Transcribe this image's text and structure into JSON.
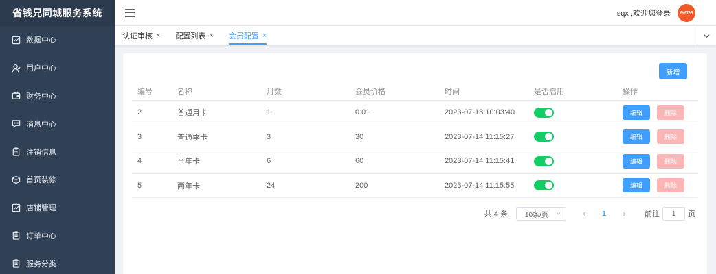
{
  "app": {
    "title": "省钱兄同城服务系统"
  },
  "sidebar": {
    "items": [
      {
        "label": "数据中心",
        "icon": "chart-icon"
      },
      {
        "label": "用户中心",
        "icon": "user-icon"
      },
      {
        "label": "财务中心",
        "icon": "wallet-icon"
      },
      {
        "label": "消息中心",
        "icon": "message-icon"
      },
      {
        "label": "注销信息",
        "icon": "clipboard-icon"
      },
      {
        "label": "首页装修",
        "icon": "box-icon"
      },
      {
        "label": "店铺管理",
        "icon": "chart-icon"
      },
      {
        "label": "订单中心",
        "icon": "clipboard-icon"
      },
      {
        "label": "服务分类",
        "icon": "clipboard-icon"
      }
    ]
  },
  "header": {
    "welcome": "sqx ,欢迎您登录",
    "avatar_text": "AVATAR"
  },
  "tabs": [
    {
      "label": "认证审核",
      "active": false
    },
    {
      "label": "配置列表",
      "active": false
    },
    {
      "label": "会员配置",
      "active": true
    }
  ],
  "toolbar": {
    "add_label": "新增"
  },
  "table": {
    "columns": [
      "编号",
      "名称",
      "月数",
      "会员价格",
      "时间",
      "是否启用",
      "操作"
    ],
    "rows": [
      {
        "id": "2",
        "name": "普通月卡",
        "months": "1",
        "price": "0.01",
        "time": "2023-07-18 10:03:40",
        "enabled": true
      },
      {
        "id": "3",
        "name": "普通季卡",
        "months": "3",
        "price": "30",
        "time": "2023-07-14 11:15:27",
        "enabled": true
      },
      {
        "id": "4",
        "name": "半年卡",
        "months": "6",
        "price": "60",
        "time": "2023-07-14 11:15:41",
        "enabled": true
      },
      {
        "id": "5",
        "name": "两年卡",
        "months": "24",
        "price": "200",
        "time": "2023-07-14 11:15:55",
        "enabled": true
      }
    ],
    "edit_label": "编辑",
    "delete_label": "删除"
  },
  "pagination": {
    "total_text": "共 4 条",
    "page_size": "10条/页",
    "current_page": "1",
    "goto_prefix": "前往",
    "goto_value": "1",
    "goto_suffix": "页"
  },
  "colors": {
    "primary": "#409eff",
    "sidebar": "#304156",
    "switch_on": "#13ce66",
    "danger_light": "#fab6b6",
    "avatar": "#f05a28"
  }
}
